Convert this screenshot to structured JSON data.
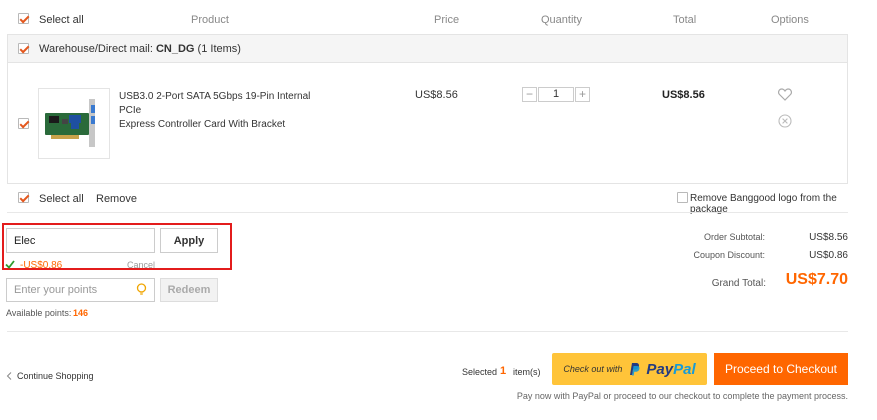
{
  "header": {
    "select_all": "Select all",
    "product": "Product",
    "price": "Price",
    "quantity": "Quantity",
    "total": "Total",
    "options": "Options"
  },
  "warehouse": {
    "prefix": "Warehouse/Direct mail:",
    "code": "CN_DG",
    "count": "(1 Items)"
  },
  "item": {
    "title_line1": "USB3.0 2-Port SATA 5Gbps 19-Pin Internal PCIe",
    "title_line2": "Express Controller Card With Bracket",
    "price": "US$8.56",
    "quantity": "1",
    "total": "US$8.56",
    "qty_minus": "−",
    "qty_plus": "+"
  },
  "footer_row": {
    "select_all": "Select all",
    "remove": "Remove",
    "remove_logo": "Remove Banggood logo from the package"
  },
  "coupon": {
    "value": "Elec",
    "apply": "Apply",
    "discount": "-US$0.86",
    "cancel": "Cancel"
  },
  "points": {
    "placeholder": "Enter your points",
    "redeem": "Redeem",
    "available_label": "Available points:",
    "available_value": "146"
  },
  "summary": {
    "subtotal_label": "Order Subtotal:",
    "subtotal_value": "US$8.56",
    "discount_label": "Coupon Discount:",
    "discount_value": "US$0.86",
    "grand_label": "Grand Total:",
    "grand_value": "US$7.70"
  },
  "checkout": {
    "continue": "Continue Shopping",
    "selected_prefix": "Selected",
    "selected_count": "1",
    "selected_suffix": "item(s)",
    "paypal_prefix": "Check out with",
    "paypal_brand_pay": "Pay",
    "paypal_brand_pal": "Pal",
    "proceed": "Proceed to Checkout",
    "note": "Pay now with PayPal or proceed to our checkout to complete the payment process."
  },
  "colors": {
    "accent": "#ff6600",
    "highlight_border": "#e31c1c",
    "paypal_bg": "#ffc439",
    "paypal_dark": "#253b80",
    "paypal_light": "#179bd7"
  }
}
